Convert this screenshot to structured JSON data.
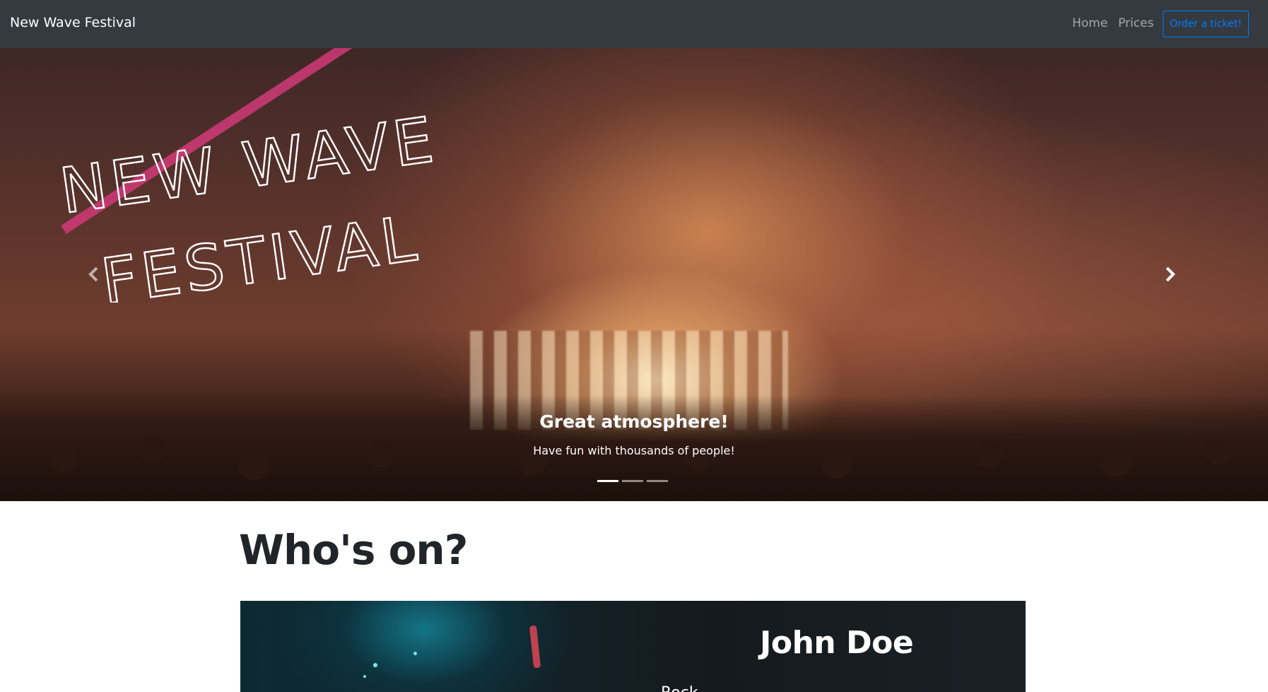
{
  "navbar": {
    "brand": "New Wave Festival",
    "links": [
      {
        "label": "Home"
      },
      {
        "label": "Prices"
      }
    ],
    "cta": "Order a ticket!"
  },
  "hero": {
    "logo_lines": [
      "NEW WAVE",
      "FESTIVAL"
    ],
    "caption_title": "Great atmosphere!",
    "caption_text": "Have fun with thousands of people!",
    "slides_count": 3,
    "active_slide": 1,
    "prev_icon": "chevron-left-icon",
    "next_icon": "chevron-right-icon"
  },
  "lineup": {
    "title": "Who's on?",
    "artists": [
      {
        "name": "John Doe",
        "role": "Rock"
      }
    ]
  },
  "colors": {
    "navbar_bg": "#343a40",
    "accent": "#007bff",
    "logo_stripe": "#d13a78"
  }
}
